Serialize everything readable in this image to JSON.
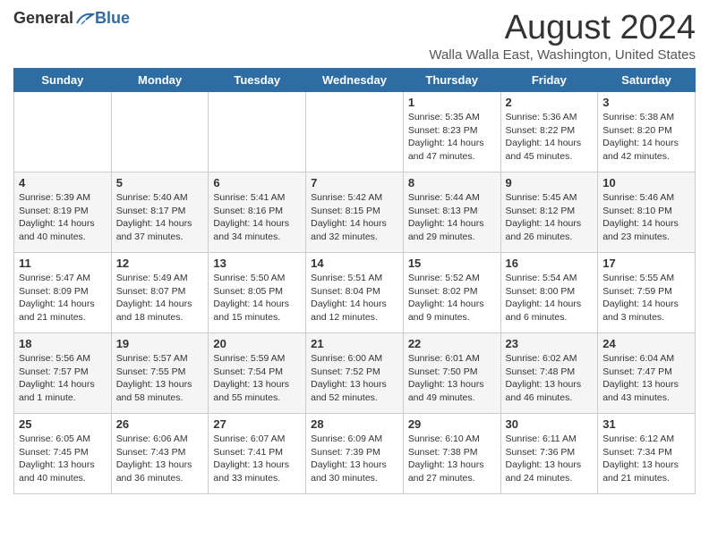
{
  "header": {
    "logo_general": "General",
    "logo_blue": "Blue",
    "month_title": "August 2024",
    "location": "Walla Walla East, Washington, United States"
  },
  "days_of_week": [
    "Sunday",
    "Monday",
    "Tuesday",
    "Wednesday",
    "Thursday",
    "Friday",
    "Saturday"
  ],
  "weeks": [
    [
      {
        "day": "",
        "info": ""
      },
      {
        "day": "",
        "info": ""
      },
      {
        "day": "",
        "info": ""
      },
      {
        "day": "",
        "info": ""
      },
      {
        "day": "1",
        "info": "Sunrise: 5:35 AM\nSunset: 8:23 PM\nDaylight: 14 hours\nand 47 minutes."
      },
      {
        "day": "2",
        "info": "Sunrise: 5:36 AM\nSunset: 8:22 PM\nDaylight: 14 hours\nand 45 minutes."
      },
      {
        "day": "3",
        "info": "Sunrise: 5:38 AM\nSunset: 8:20 PM\nDaylight: 14 hours\nand 42 minutes."
      }
    ],
    [
      {
        "day": "4",
        "info": "Sunrise: 5:39 AM\nSunset: 8:19 PM\nDaylight: 14 hours\nand 40 minutes."
      },
      {
        "day": "5",
        "info": "Sunrise: 5:40 AM\nSunset: 8:17 PM\nDaylight: 14 hours\nand 37 minutes."
      },
      {
        "day": "6",
        "info": "Sunrise: 5:41 AM\nSunset: 8:16 PM\nDaylight: 14 hours\nand 34 minutes."
      },
      {
        "day": "7",
        "info": "Sunrise: 5:42 AM\nSunset: 8:15 PM\nDaylight: 14 hours\nand 32 minutes."
      },
      {
        "day": "8",
        "info": "Sunrise: 5:44 AM\nSunset: 8:13 PM\nDaylight: 14 hours\nand 29 minutes."
      },
      {
        "day": "9",
        "info": "Sunrise: 5:45 AM\nSunset: 8:12 PM\nDaylight: 14 hours\nand 26 minutes."
      },
      {
        "day": "10",
        "info": "Sunrise: 5:46 AM\nSunset: 8:10 PM\nDaylight: 14 hours\nand 23 minutes."
      }
    ],
    [
      {
        "day": "11",
        "info": "Sunrise: 5:47 AM\nSunset: 8:09 PM\nDaylight: 14 hours\nand 21 minutes."
      },
      {
        "day": "12",
        "info": "Sunrise: 5:49 AM\nSunset: 8:07 PM\nDaylight: 14 hours\nand 18 minutes."
      },
      {
        "day": "13",
        "info": "Sunrise: 5:50 AM\nSunset: 8:05 PM\nDaylight: 14 hours\nand 15 minutes."
      },
      {
        "day": "14",
        "info": "Sunrise: 5:51 AM\nSunset: 8:04 PM\nDaylight: 14 hours\nand 12 minutes."
      },
      {
        "day": "15",
        "info": "Sunrise: 5:52 AM\nSunset: 8:02 PM\nDaylight: 14 hours\nand 9 minutes."
      },
      {
        "day": "16",
        "info": "Sunrise: 5:54 AM\nSunset: 8:00 PM\nDaylight: 14 hours\nand 6 minutes."
      },
      {
        "day": "17",
        "info": "Sunrise: 5:55 AM\nSunset: 7:59 PM\nDaylight: 14 hours\nand 3 minutes."
      }
    ],
    [
      {
        "day": "18",
        "info": "Sunrise: 5:56 AM\nSunset: 7:57 PM\nDaylight: 14 hours\nand 1 minute."
      },
      {
        "day": "19",
        "info": "Sunrise: 5:57 AM\nSunset: 7:55 PM\nDaylight: 13 hours\nand 58 minutes."
      },
      {
        "day": "20",
        "info": "Sunrise: 5:59 AM\nSunset: 7:54 PM\nDaylight: 13 hours\nand 55 minutes."
      },
      {
        "day": "21",
        "info": "Sunrise: 6:00 AM\nSunset: 7:52 PM\nDaylight: 13 hours\nand 52 minutes."
      },
      {
        "day": "22",
        "info": "Sunrise: 6:01 AM\nSunset: 7:50 PM\nDaylight: 13 hours\nand 49 minutes."
      },
      {
        "day": "23",
        "info": "Sunrise: 6:02 AM\nSunset: 7:48 PM\nDaylight: 13 hours\nand 46 minutes."
      },
      {
        "day": "24",
        "info": "Sunrise: 6:04 AM\nSunset: 7:47 PM\nDaylight: 13 hours\nand 43 minutes."
      }
    ],
    [
      {
        "day": "25",
        "info": "Sunrise: 6:05 AM\nSunset: 7:45 PM\nDaylight: 13 hours\nand 40 minutes."
      },
      {
        "day": "26",
        "info": "Sunrise: 6:06 AM\nSunset: 7:43 PM\nDaylight: 13 hours\nand 36 minutes."
      },
      {
        "day": "27",
        "info": "Sunrise: 6:07 AM\nSunset: 7:41 PM\nDaylight: 13 hours\nand 33 minutes."
      },
      {
        "day": "28",
        "info": "Sunrise: 6:09 AM\nSunset: 7:39 PM\nDaylight: 13 hours\nand 30 minutes."
      },
      {
        "day": "29",
        "info": "Sunrise: 6:10 AM\nSunset: 7:38 PM\nDaylight: 13 hours\nand 27 minutes."
      },
      {
        "day": "30",
        "info": "Sunrise: 6:11 AM\nSunset: 7:36 PM\nDaylight: 13 hours\nand 24 minutes."
      },
      {
        "day": "31",
        "info": "Sunrise: 6:12 AM\nSunset: 7:34 PM\nDaylight: 13 hours\nand 21 minutes."
      }
    ]
  ]
}
